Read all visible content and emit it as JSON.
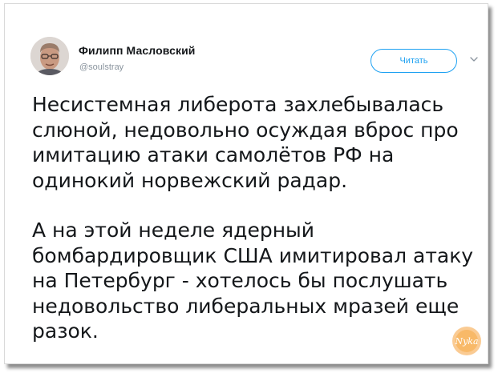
{
  "tweet": {
    "author": {
      "display_name": "Филипп Масловский",
      "handle": "@soulstray"
    },
    "follow_button_label": "Читать",
    "paragraphs": [
      {
        "lines": [
          "Несистемная либерота захлебывалась",
          "слюной, недовольно осуждая вброс про",
          "имитацию атаки самолётов РФ на",
          "одинокий норвежский радар."
        ]
      },
      {
        "lines": [
          "А на этой неделе ядерный",
          "бомбардировщик США имитировал атаку",
          "на Петербург - хотелось бы послушать",
          "недовольство либеральных мразей еще",
          "разок."
        ]
      }
    ]
  },
  "watermark": {
    "text": "Nyka",
    "color": "#f29a2e"
  },
  "colors": {
    "accent": "#1da1f2",
    "text": "#14171a",
    "muted": "#8a949e"
  },
  "icons": {
    "avatar": "avatar-photo",
    "menu": "chevron-down-icon"
  }
}
